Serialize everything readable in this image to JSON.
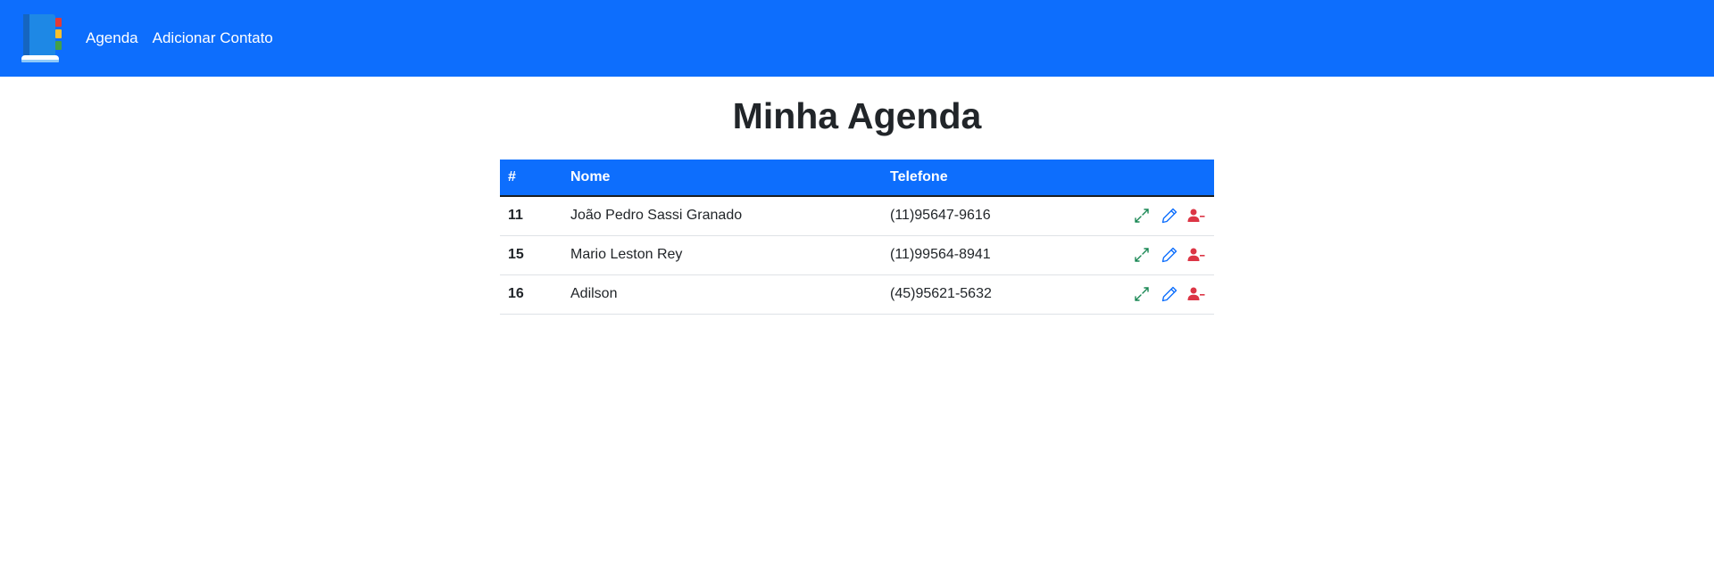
{
  "navbar": {
    "logo_icon": "address-book-icon",
    "links": [
      {
        "label": "Agenda"
      },
      {
        "label": "Adicionar Contato"
      }
    ],
    "color": "#0d6efd"
  },
  "main": {
    "title": "Minha Agenda"
  },
  "table": {
    "headers": {
      "id": "#",
      "name": "Nome",
      "phone": "Telefone",
      "actions": ""
    },
    "rows": [
      {
        "id": "11",
        "name": "João Pedro Sassi Granado",
        "phone": "(11)95647-9616"
      },
      {
        "id": "15",
        "name": "Mario Leston Rey",
        "phone": "(11)99564-8941"
      },
      {
        "id": "16",
        "name": "Adilson",
        "phone": "(45)95621-5632"
      }
    ],
    "row_actions": [
      {
        "icon": "expand-icon",
        "color": "#198754"
      },
      {
        "icon": "pencil-icon",
        "color": "#0d6efd"
      },
      {
        "icon": "person-dash-icon",
        "color": "#dc3545"
      }
    ]
  }
}
